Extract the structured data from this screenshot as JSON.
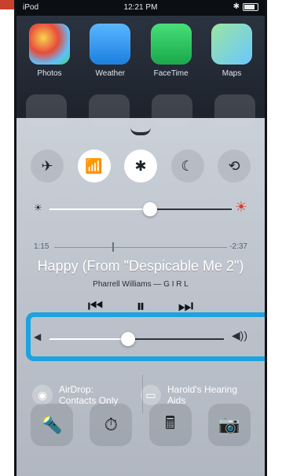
{
  "status_bar": {
    "left": "iPod",
    "time": "12:21 PM",
    "right": "✱"
  },
  "home_apps": [
    {
      "label": "Photos",
      "icon": "photos-icon"
    },
    {
      "label": "Weather",
      "icon": "weather-icon"
    },
    {
      "label": "FaceTime",
      "icon": "facetime-icon"
    },
    {
      "label": "Maps",
      "icon": "maps-icon"
    }
  ],
  "toggles": [
    {
      "name": "airplane",
      "glyph": "✈",
      "on": false
    },
    {
      "name": "wifi",
      "glyph": "📶",
      "on": true
    },
    {
      "name": "bluetooth",
      "glyph": "✱",
      "on": true
    },
    {
      "name": "do-not-disturb",
      "glyph": "☾",
      "on": false
    },
    {
      "name": "rotation-lock",
      "glyph": "⟲",
      "on": false
    }
  ],
  "brightness": {
    "level": 0.55
  },
  "media": {
    "elapsed": "1:15",
    "remaining": "-2:37",
    "progress": 0.34,
    "title": "Happy (From \"Despicable Me 2\")",
    "artist": "Pharrell Williams — G I R L",
    "prev": "⏮",
    "play_pause": "⏸",
    "next": "⏭"
  },
  "volume": {
    "level": 0.45
  },
  "airdrop": {
    "title": "AirDrop:",
    "value": "Contacts Only"
  },
  "hearing_aids": {
    "title": "Harold's Hearing",
    "value": "Aids"
  },
  "dock": [
    {
      "name": "flashlight",
      "glyph": "🔦"
    },
    {
      "name": "timer",
      "glyph": "⏱"
    },
    {
      "name": "calculator",
      "glyph": "🖩"
    },
    {
      "name": "camera",
      "glyph": "📷"
    }
  ],
  "colors": {
    "accent": "#1da3df",
    "banner": "#c8412c"
  }
}
